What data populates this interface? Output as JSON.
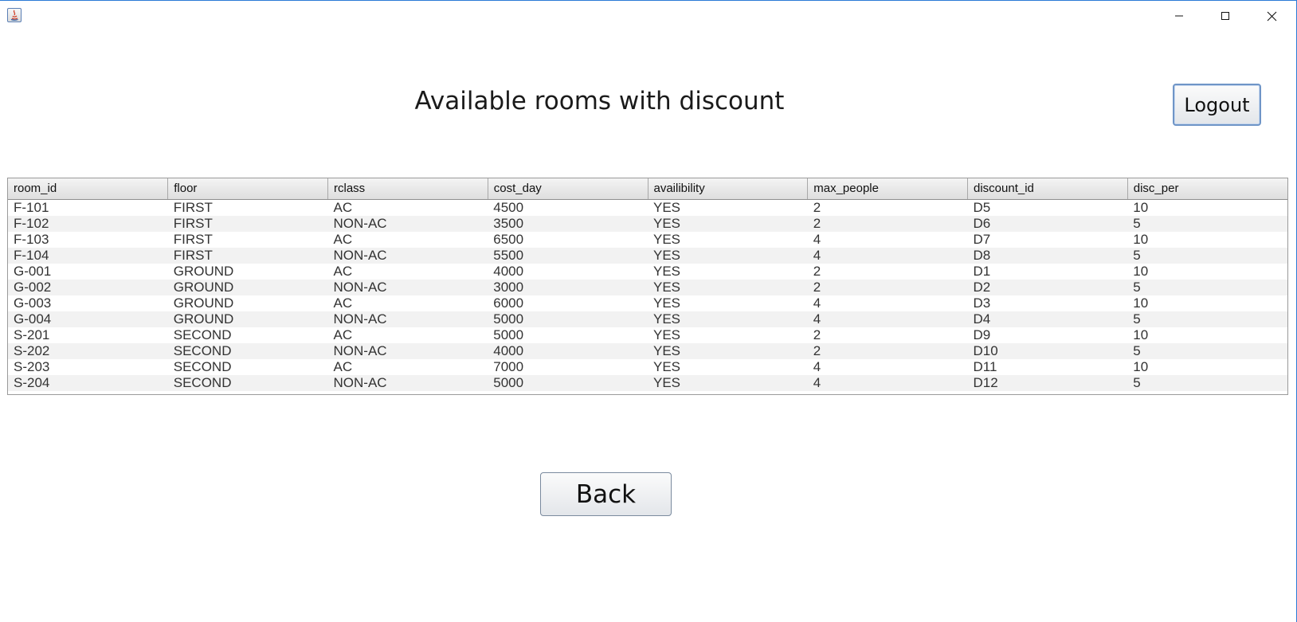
{
  "window": {
    "controls": {
      "minimize_icon": "minimize-icon",
      "maximize_icon": "maximize-icon",
      "close_icon": "close-icon"
    }
  },
  "header": {
    "title": "Available rooms with discount",
    "logout_label": "Logout"
  },
  "table": {
    "columns": [
      "room_id",
      "floor",
      "rclass",
      "cost_day",
      "availibility",
      "max_people",
      "discount_id",
      "disc_per"
    ],
    "rows": [
      [
        "F-101",
        "FIRST",
        "AC",
        "4500",
        "YES",
        "2",
        "D5",
        "10"
      ],
      [
        "F-102",
        "FIRST",
        "NON-AC",
        "3500",
        "YES",
        "2",
        "D6",
        "5"
      ],
      [
        "F-103",
        "FIRST",
        "AC",
        "6500",
        "YES",
        "4",
        "D7",
        "10"
      ],
      [
        "F-104",
        "FIRST",
        "NON-AC",
        "5500",
        "YES",
        "4",
        "D8",
        "5"
      ],
      [
        "G-001",
        "GROUND",
        "AC",
        "4000",
        "YES",
        "2",
        "D1",
        "10"
      ],
      [
        "G-002",
        "GROUND",
        "NON-AC",
        "3000",
        "YES",
        "2",
        "D2",
        "5"
      ],
      [
        "G-003",
        "GROUND",
        "AC",
        "6000",
        "YES",
        "4",
        "D3",
        "10"
      ],
      [
        "G-004",
        "GROUND",
        "NON-AC",
        "5000",
        "YES",
        "4",
        "D4",
        "5"
      ],
      [
        "S-201",
        "SECOND",
        "AC",
        "5000",
        "YES",
        "2",
        "D9",
        "10"
      ],
      [
        "S-202",
        "SECOND",
        "NON-AC",
        "4000",
        "YES",
        "2",
        "D10",
        "5"
      ],
      [
        "S-203",
        "SECOND",
        "AC",
        "7000",
        "YES",
        "4",
        "D11",
        "10"
      ],
      [
        "S-204",
        "SECOND",
        "NON-AC",
        "5000",
        "YES",
        "4",
        "D12",
        "5"
      ]
    ]
  },
  "footer": {
    "back_label": "Back"
  }
}
